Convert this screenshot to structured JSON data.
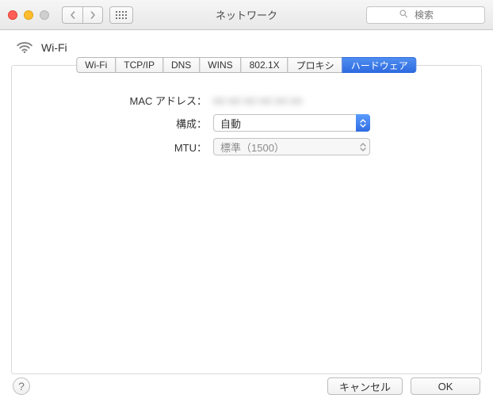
{
  "window": {
    "title": "ネットワーク",
    "search_placeholder": "検索"
  },
  "header": {
    "section": "Wi-Fi"
  },
  "tabs": [
    {
      "id": "wifi",
      "label": "Wi-Fi"
    },
    {
      "id": "tcpip",
      "label": "TCP/IP"
    },
    {
      "id": "dns",
      "label": "DNS"
    },
    {
      "id": "wins",
      "label": "WINS"
    },
    {
      "id": "8021x",
      "label": "802.1X"
    },
    {
      "id": "proxy",
      "label": "プロキシ"
    },
    {
      "id": "hardware",
      "label": "ハードウェア"
    }
  ],
  "active_tab": "hardware",
  "form": {
    "mac_label": "MAC アドレス：",
    "mac_value": "xx:xx:xx:xx:xx:xx",
    "config_label": "構成：",
    "config_value": "自動",
    "mtu_label": "MTU：",
    "mtu_value": "標準（1500）"
  },
  "footer": {
    "help": "?",
    "cancel": "キャンセル",
    "ok": "OK"
  }
}
